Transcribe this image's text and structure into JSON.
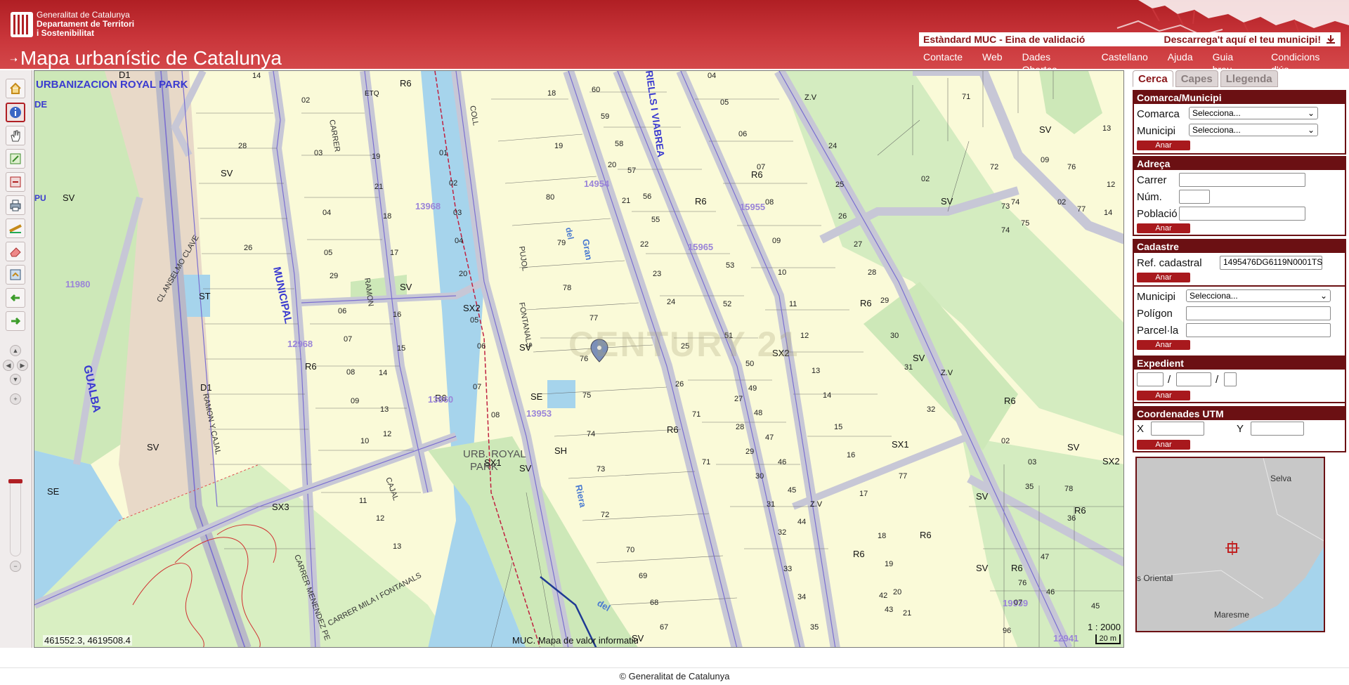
{
  "header": {
    "org_line1": "Generalitat de Catalunya",
    "org_line2": "Departament de Territori",
    "org_line3": "i Sostenibilitat",
    "app_title": "Mapa urbanístic de Catalunya",
    "muc_standard": "Estàndard MUC - Eina de validació",
    "download": "Descarrega't aquí el teu municipi!",
    "nav": [
      "Contacte",
      "Web",
      "Dades Obertes",
      "Castellano",
      "Ajuda",
      "Guia breu",
      "Condicions d'ús"
    ],
    "brand_color": "#b01f24"
  },
  "toolbar": {
    "icons": [
      "home-icon",
      "info-icon",
      "pan-hand-icon",
      "zoom-in-rect-icon",
      "zoom-out-rect-icon",
      "print-icon",
      "measure-icon",
      "erase-icon",
      "layers-icon",
      "back-arrow-icon",
      "forward-arrow-icon"
    ],
    "active": "info-icon"
  },
  "map": {
    "coordinates": "461552.3, 4619508.4",
    "layer_name": "MUC. Mapa de valor informatiu",
    "scale": "1 : 2000",
    "scale_bar": "20 m",
    "watermark": "CENTURY 21",
    "labels": {
      "urbanizacion": "URBANIZACION ROYAL PARK",
      "municipal": "MUNICIPAL",
      "ramon": "RAMON",
      "gualba": "GUALBA",
      "pujol": "PUJOL",
      "fontanals": "FONTANALS",
      "viabrea": "RIELLS I VIABREA",
      "gran": "Gran",
      "riera": "Riera",
      "del": "del",
      "urb": "URB. ROYAL",
      "park": "PARK",
      "carrer": "CARRER",
      "coll": "COLL",
      "mila": "CARRER MILA I FONTANALS",
      "anselmo": "CL ANSELMO CLAVE",
      "cajal": "CAJAL",
      "ramon_cajal": "RAMON Y CAJAL",
      "menendez": "CARRER MENENDEZ PE",
      "de": "DE",
      "pu": "PU"
    },
    "zones": [
      "SV",
      "R6",
      "SX2",
      "SX1",
      "SX3",
      "SE",
      "SH",
      "ST",
      "D1",
      "Z.V",
      "ETQ"
    ],
    "parcel_ids": [
      "11980",
      "12968",
      "13968",
      "14954",
      "15965",
      "13953",
      "19939",
      "13860",
      "15955",
      "12941"
    ]
  },
  "panel": {
    "tabs": [
      "Cerca",
      "Capes",
      "Llegenda"
    ],
    "active_tab": "Cerca",
    "comarca_section": {
      "title": "Comarca/Municipi",
      "comarca_label": "Comarca",
      "municipi_label": "Municipi",
      "comarca_value": "Selecciona...",
      "municipi_value": "Selecciona...",
      "go": "Anar"
    },
    "adreca_section": {
      "title": "Adreça",
      "carrer": "Carrer",
      "num": "Núm.",
      "poblacio": "Població",
      "go": "Anar"
    },
    "cadastre_section": {
      "title": "Cadastre",
      "ref_label": "Ref. cadastral",
      "ref_value": "1495476DG6119N0001TS",
      "go": "Anar",
      "municipi_label": "Municipi",
      "municipi_value": "Selecciona...",
      "poligon": "Polígon",
      "parcela": "Parcel·la",
      "go2": "Anar"
    },
    "expedient_section": {
      "title": "Expedient",
      "sep": "/",
      "go": "Anar"
    },
    "utm_section": {
      "title": "Coordenades UTM",
      "x": "X",
      "y": "Y",
      "go": "Anar"
    },
    "minimap": {
      "selva": "Selva",
      "oriental": "s Oriental",
      "maresme": "Maresme"
    }
  },
  "footer": {
    "copyright": "© Generalitat de Catalunya"
  }
}
